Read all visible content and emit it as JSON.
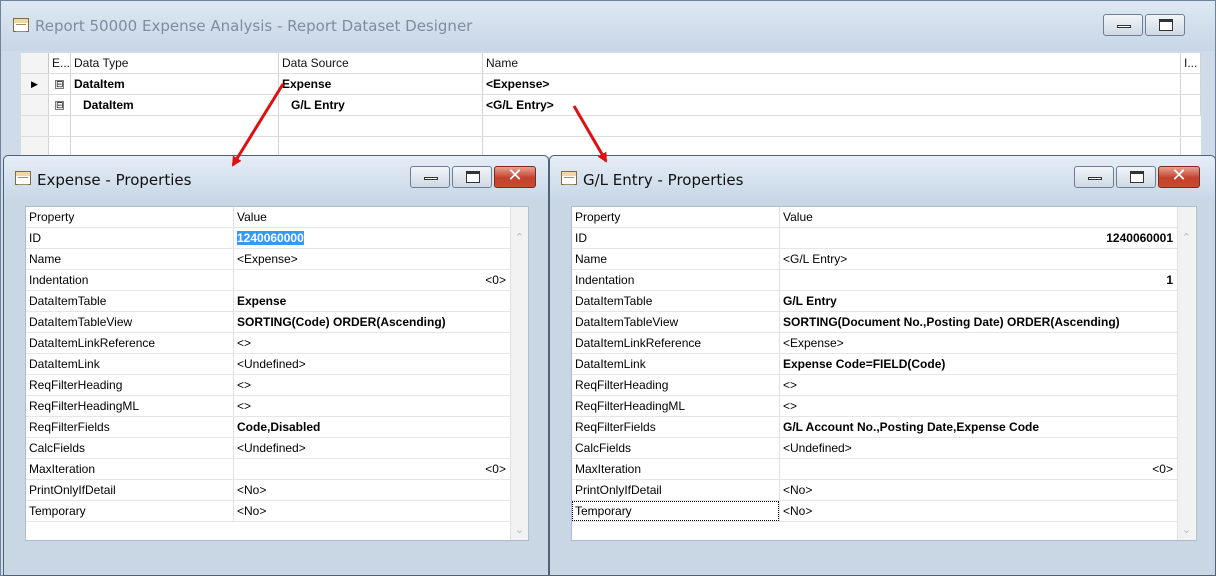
{
  "main": {
    "title": "Report 50000 Expense Analysis - Report Dataset Designer",
    "columns": {
      "e": "E...",
      "data_type": "Data Type",
      "data_source": "Data Source",
      "name": "Name",
      "i": "I..."
    },
    "rows": [
      {
        "tree": "⊟",
        "data_type": "DataItem",
        "data_source": "Expense",
        "name": "<Expense>"
      },
      {
        "tree": "⊟",
        "data_type": "DataItem",
        "data_source": "G/L Entry",
        "name": "<G/L Entry>"
      }
    ]
  },
  "left_props": {
    "title": "Expense - Properties",
    "header": {
      "property": "Property",
      "value": "Value"
    },
    "rows": [
      {
        "property": "ID",
        "value": "1240060000"
      },
      {
        "property": "Name",
        "value": "<Expense>"
      },
      {
        "property": "Indentation",
        "value": "<0>"
      },
      {
        "property": "DataItemTable",
        "value": "Expense"
      },
      {
        "property": "DataItemTableView",
        "value": "SORTING(Code) ORDER(Ascending)"
      },
      {
        "property": "DataItemLinkReference",
        "value": "<>"
      },
      {
        "property": "DataItemLink",
        "value": "<Undefined>"
      },
      {
        "property": "ReqFilterHeading",
        "value": "<>"
      },
      {
        "property": "ReqFilterHeadingML",
        "value": "<>"
      },
      {
        "property": "ReqFilterFields",
        "value": "Code,Disabled"
      },
      {
        "property": "CalcFields",
        "value": "<Undefined>"
      },
      {
        "property": "MaxIteration",
        "value": "<0>"
      },
      {
        "property": "PrintOnlyIfDetail",
        "value": "<No>"
      },
      {
        "property": "Temporary",
        "value": "<No>"
      }
    ]
  },
  "right_props": {
    "title": "G/L Entry - Properties",
    "header": {
      "property": "Property",
      "value": "Value"
    },
    "rows": [
      {
        "property": "ID",
        "value": "1240060001"
      },
      {
        "property": "Name",
        "value": "<G/L Entry>"
      },
      {
        "property": "Indentation",
        "value": "1"
      },
      {
        "property": "DataItemTable",
        "value": "G/L Entry"
      },
      {
        "property": "DataItemTableView",
        "value": "SORTING(Document No.,Posting Date) ORDER(Ascending)"
      },
      {
        "property": "DataItemLinkReference",
        "value": "<Expense>"
      },
      {
        "property": "DataItemLink",
        "value": "Expense Code=FIELD(Code)"
      },
      {
        "property": "ReqFilterHeading",
        "value": "<>"
      },
      {
        "property": "ReqFilterHeadingML",
        "value": "<>"
      },
      {
        "property": "ReqFilterFields",
        "value": "G/L Account No.,Posting Date,Expense Code"
      },
      {
        "property": "CalcFields",
        "value": "<Undefined>"
      },
      {
        "property": "MaxIteration",
        "value": "<0>"
      },
      {
        "property": "PrintOnlyIfDetail",
        "value": "<No>"
      },
      {
        "property": "Temporary",
        "value": "<No>"
      }
    ]
  },
  "colors": {
    "arrow": "#e01010",
    "selection": "#3399ff",
    "close_button": "#c84b33"
  },
  "icons": {
    "window": "table-icon",
    "minimize": "minimize-icon",
    "maximize": "maximize-icon",
    "close": "close-icon"
  }
}
